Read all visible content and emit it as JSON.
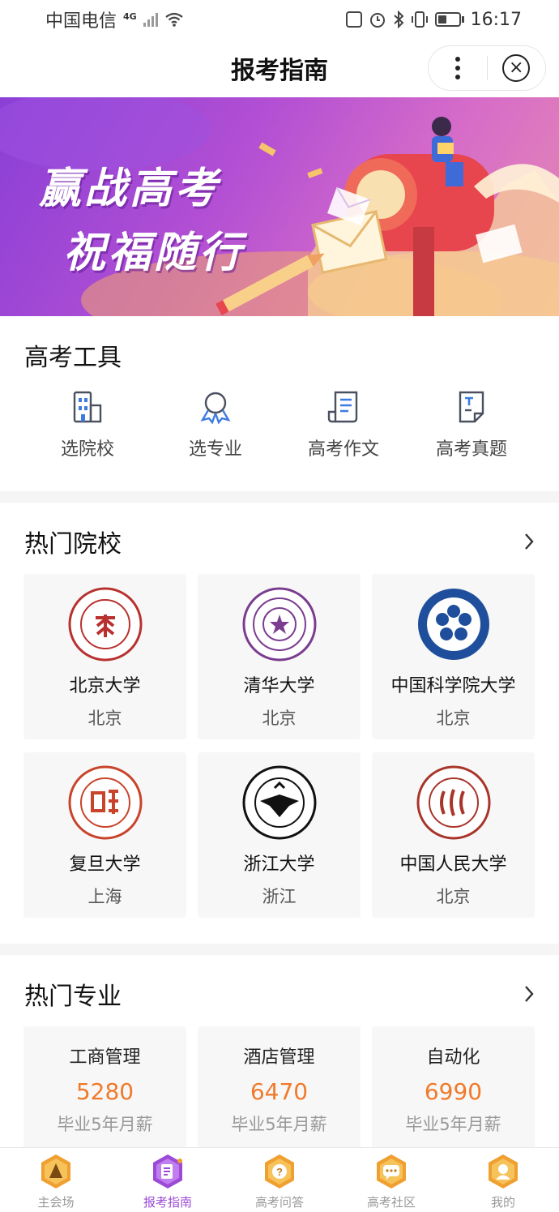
{
  "status_bar": {
    "carrier": "中国电信",
    "network": "4G",
    "time": "16:17"
  },
  "nav": {
    "title": "报考指南"
  },
  "banner": {
    "line1": "赢战高考",
    "line2": "祝福随行"
  },
  "tools": {
    "title": "高考工具",
    "items": [
      {
        "label": "选院校",
        "icon": "building-icon"
      },
      {
        "label": "选专业",
        "icon": "award-icon"
      },
      {
        "label": "高考作文",
        "icon": "document-icon"
      },
      {
        "label": "高考真题",
        "icon": "exam-paper-icon"
      }
    ]
  },
  "hot_schools": {
    "title": "热门院校",
    "items": [
      {
        "name": "北京大学",
        "city": "北京",
        "color": "#b8312f"
      },
      {
        "name": "清华大学",
        "city": "北京",
        "color": "#7a3d8f"
      },
      {
        "name": "中国科学院大学",
        "city": "北京",
        "color": "#1f4f9c"
      },
      {
        "name": "复旦大学",
        "city": "上海",
        "color": "#c8442a"
      },
      {
        "name": "浙江大学",
        "city": "浙江",
        "color": "#111111"
      },
      {
        "name": "中国人民大学",
        "city": "北京",
        "color": "#a8352a"
      }
    ]
  },
  "hot_majors": {
    "title": "热门专业",
    "items": [
      {
        "name": "工商管理",
        "salary": "5280",
        "label": "毕业5年月薪"
      },
      {
        "name": "酒店管理",
        "salary": "6470",
        "label": "毕业5年月薪"
      },
      {
        "name": "自动化",
        "salary": "6990",
        "label": "毕业5年月薪"
      }
    ]
  },
  "tab_bar": {
    "items": [
      {
        "label": "主会场",
        "icon": "home-tab-icon"
      },
      {
        "label": "报考指南",
        "icon": "guide-tab-icon",
        "active": true
      },
      {
        "label": "高考问答",
        "icon": "question-tab-icon"
      },
      {
        "label": "高考社区",
        "icon": "community-tab-icon"
      },
      {
        "label": "我的",
        "icon": "profile-tab-icon"
      }
    ]
  },
  "colors": {
    "accent_purple": "#9b4bd6",
    "salary_orange": "#f07a2a",
    "tab_orange": "#f0a030"
  }
}
